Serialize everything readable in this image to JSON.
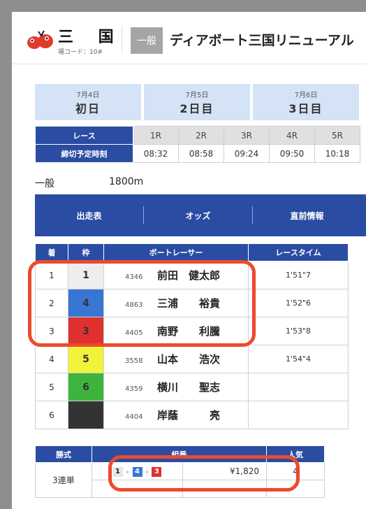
{
  "header": {
    "venue": "三 国",
    "venue_code": "場コード：10#",
    "grade": "一般",
    "race_title": "ディアボート三国リニューアル"
  },
  "days": [
    {
      "date": "7月4日",
      "name": "初日"
    },
    {
      "date": "7月5日",
      "name": "2日目"
    },
    {
      "date": "7月6日",
      "name": "3日目"
    }
  ],
  "race_table": {
    "race_label": "レース",
    "time_label": "締切予定時刻",
    "races": [
      "1R",
      "2R",
      "3R",
      "4R",
      "5R"
    ],
    "times": [
      "08:32",
      "08:58",
      "09:24",
      "09:50",
      "10:18"
    ]
  },
  "race_info": {
    "class": "一般",
    "distance": "1800m"
  },
  "buttons": [
    "出走表",
    "オッズ",
    "直前情報"
  ],
  "results": {
    "headers": [
      "着",
      "枠",
      "ボートレーサー",
      "レースタイム"
    ],
    "rows": [
      {
        "place": "1",
        "frame": "1",
        "racer_id": "4346",
        "name": "前田　健太郎",
        "time": "1'51\"7"
      },
      {
        "place": "2",
        "frame": "4",
        "racer_id": "4863",
        "name": "三浦　　裕貴",
        "time": "1'52\"6"
      },
      {
        "place": "3",
        "frame": "3",
        "racer_id": "4405",
        "name": "南野　　利騰",
        "time": "1'53\"8"
      },
      {
        "place": "4",
        "frame": "5",
        "racer_id": "3558",
        "name": "山本　　浩次",
        "time": "1'54\"4"
      },
      {
        "place": "5",
        "frame": "6",
        "racer_id": "4359",
        "name": "横川　　聖志",
        "time": ""
      },
      {
        "place": "6",
        "frame": "2",
        "racer_id": "4404",
        "name": "岸蔭　　　亮",
        "time": ""
      }
    ]
  },
  "payout": {
    "headers": [
      "勝式",
      "組番",
      "払戻金",
      "人気"
    ],
    "bet_type": "3連単",
    "combination": [
      "1",
      "4",
      "3"
    ],
    "separator": "-",
    "amount": "¥1,820",
    "popularity": "4"
  },
  "colors": {
    "accent": "#2a4da3",
    "highlight": "#ec4a2c",
    "frame_1": "#eeeeee",
    "frame_2": "#000000",
    "frame_3": "#e03030",
    "frame_4": "#3876d4",
    "frame_5": "#f2f23a",
    "frame_6": "#3eb43e"
  }
}
